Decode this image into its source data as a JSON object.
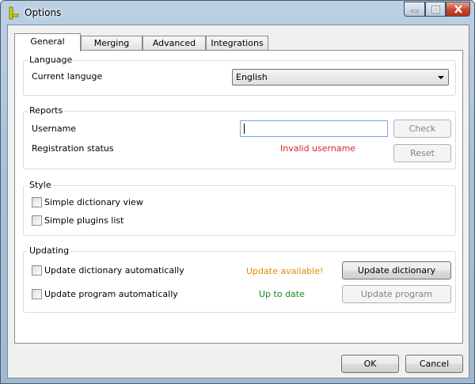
{
  "window": {
    "title": "Options"
  },
  "tabs": [
    {
      "label": "General"
    },
    {
      "label": "Merging"
    },
    {
      "label": "Advanced"
    },
    {
      "label": "Integrations"
    }
  ],
  "language": {
    "group_label": "Language",
    "current_label": "Current languge",
    "selected": "English"
  },
  "reports": {
    "group_label": "Reports",
    "username_label": "Username",
    "username_value": "",
    "registration_label": "Registration status",
    "registration_status": "Invalid username",
    "check_label": "Check",
    "reset_label": "Reset"
  },
  "style": {
    "group_label": "Style",
    "simple_dictionary_view": "Simple dictionary view",
    "simple_plugins_list": "Simple plugins list"
  },
  "updating": {
    "group_label": "Updating",
    "update_dictionary_auto": "Update dictionary automatically",
    "update_program_auto": "Update program automatically",
    "dictionary_status": "Update available!",
    "program_status": "Up to date",
    "update_dictionary_button": "Update dictionary",
    "update_program_button": "Update program"
  },
  "footer": {
    "ok_label": "OK",
    "cancel_label": "Cancel"
  },
  "colors": {
    "error": "#e02020",
    "warning": "#e08a00",
    "ok": "#1a8a1a",
    "accent_border": "#7aa7d9"
  }
}
